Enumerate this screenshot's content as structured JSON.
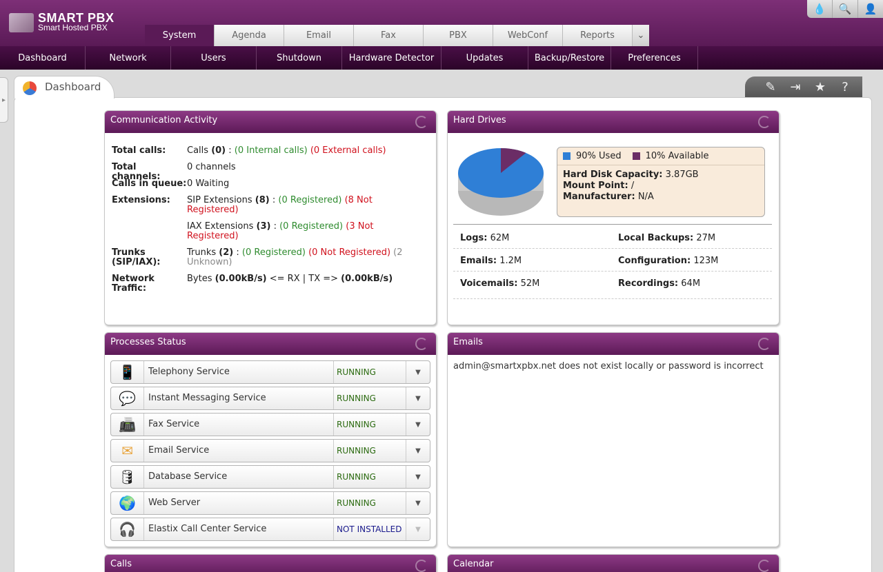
{
  "brand": {
    "name": "SMART PBX",
    "tagline": "Smart Hosted PBX"
  },
  "top_tools": [
    {
      "name": "theme-icon",
      "glyph": "💧"
    },
    {
      "name": "search-icon",
      "glyph": "🔍"
    },
    {
      "name": "user-icon",
      "glyph": "👤"
    }
  ],
  "main_tabs": [
    "System",
    "Agenda",
    "Email",
    "Fax",
    "PBX",
    "WebConf",
    "Reports"
  ],
  "active_main_tab": "System",
  "sub_nav": [
    "Dashboard",
    "Network",
    "Users",
    "Shutdown",
    "Hardware Detector",
    "Updates",
    "Backup/Restore",
    "Preferences"
  ],
  "page": {
    "title": "Dashboard"
  },
  "comm": {
    "title": "Communication Activity",
    "total_calls": {
      "label": "Total calls:",
      "prefix": "Calls ",
      "count": "(0)",
      "sep": " : ",
      "internal": "(0 Internal calls)",
      "external": "(0 External calls)"
    },
    "total_channels": {
      "label": "Total channels:",
      "value": "0 channels"
    },
    "calls_queue": {
      "label": "Calls in queue:",
      "value": "0 Waiting"
    },
    "extensions": {
      "label": "Extensions:",
      "sip_prefix": "SIP Extensions ",
      "sip_count": "(8)",
      "sip_reg": "(0 Registered)",
      "sip_notreg": "(8 Not Registered)",
      "iax_prefix": "IAX Extensions ",
      "iax_count": "(3)",
      "iax_reg": "(0 Registered)",
      "iax_notreg": "(3 Not Registered)"
    },
    "trunks": {
      "label": "Trunks (SIP/IAX):",
      "prefix": "Trunks ",
      "count": "(2)",
      "reg": "(0 Registered)",
      "notreg": "(0 Not Registered)",
      "unknown": "(2 Unknown)"
    },
    "traffic": {
      "label": "Network Traffic:",
      "prefix": "Bytes ",
      "rx": "(0.00kB/s)",
      "mid": " <= RX | TX => ",
      "tx": "(0.00kB/s)"
    }
  },
  "hard_drives": {
    "title": "Hard Drives",
    "used_pct": 90,
    "used_label": "90% Used",
    "avail_label": "10% Available",
    "used_color": "#2f7fd6",
    "avail_color": "#6b2d66",
    "capacity_label": "Hard Disk Capacity:",
    "capacity": "3.87GB",
    "mount_label": "Mount Point:",
    "mount": "/",
    "mfr_label": "Manufacturer:",
    "mfr": "N/A",
    "stats": [
      {
        "label": "Logs:",
        "value": "62M"
      },
      {
        "label": "Local Backups:",
        "value": "27M"
      },
      {
        "label": "Emails:",
        "value": "1.2M"
      },
      {
        "label": "Configuration:",
        "value": "123M"
      },
      {
        "label": "Voicemails:",
        "value": "52M"
      },
      {
        "label": "Recordings:",
        "value": "64M"
      }
    ]
  },
  "processes": {
    "title": "Processes Status",
    "items": [
      {
        "name": "Telephony Service",
        "status": "RUNNING",
        "icon": "📱"
      },
      {
        "name": "Instant Messaging Service",
        "status": "RUNNING",
        "icon": "💬"
      },
      {
        "name": "Fax Service",
        "status": "RUNNING",
        "icon": "📠"
      },
      {
        "name": "Email Service",
        "status": "RUNNING",
        "icon": "✉"
      },
      {
        "name": "Database Service",
        "status": "RUNNING",
        "icon": "🛢"
      },
      {
        "name": "Web Server",
        "status": "RUNNING",
        "icon": "🌍"
      },
      {
        "name": "Elastix Call Center Service",
        "status": "NOT INSTALLED",
        "icon": "🎧"
      }
    ]
  },
  "emails": {
    "title": "Emails",
    "message": "admin@smartxpbx.net does not exist locally or password is incorrect"
  },
  "calls": {
    "title": "Calls"
  },
  "calendar": {
    "title": "Calendar"
  }
}
